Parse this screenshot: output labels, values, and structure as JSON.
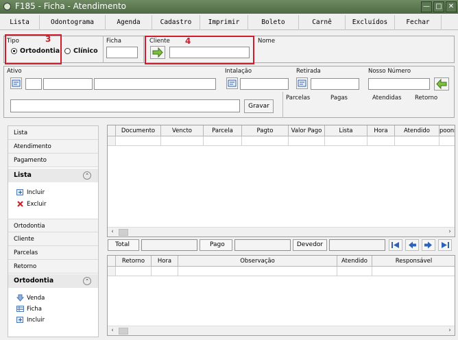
{
  "window": {
    "title": "F185 - Ficha - Atendimento"
  },
  "menu": [
    "Lista",
    "Odontograma",
    "Agenda",
    "Cadastro",
    "Imprimir",
    "Boleto",
    "Carnê",
    "Excluídos",
    "Fechar"
  ],
  "form": {
    "tipo_label": "Tipo",
    "tipo_options": [
      "Ortodontia",
      "Clínico"
    ],
    "tipo_selected": "Ortodontia",
    "ficha_label": "Ficha",
    "ficha_value": "",
    "cliente_label": "Cliente",
    "cliente_value": "",
    "nome_label": "Nome",
    "nome_value": "",
    "ativo_label": "Ativo",
    "instalacao_label": "Intalação",
    "retirada_label": "Retirada",
    "nosso_numero_label": "Nosso Número",
    "gravar_label": "Gravar",
    "summary_headers": [
      "Parcelas",
      "Pagas",
      "Atendidas",
      "Retorno"
    ]
  },
  "annotations": {
    "marker_3": "3",
    "marker_4": "4"
  },
  "sidebar": {
    "items_top": [
      "Lista",
      "Atendimento",
      "Pagamento"
    ],
    "lista_section": {
      "title": "Lista",
      "actions": [
        "Incluir",
        "Excluir"
      ]
    },
    "items_mid": [
      "Ortodontia",
      "Cliente",
      "Parcelas",
      "Retorno"
    ],
    "ortodontia_section": {
      "title": "Ortodontia",
      "actions": [
        "Venda",
        "Ficha",
        "Incluir"
      ]
    }
  },
  "grid1": {
    "columns": [
      "Documento",
      "Vencto",
      "Parcela",
      "Pagto",
      "Valor Pago",
      "Lista",
      "Hora",
      "Atendido",
      "poons"
    ]
  },
  "totals": {
    "total_label": "Total",
    "pago_label": "Pago",
    "devedor_label": "Devedor"
  },
  "grid2": {
    "columns": [
      "Retorno",
      "Hora",
      "Observação",
      "Atendido",
      "Responsável"
    ]
  },
  "colors": {
    "titlebar": "#5c7852",
    "annotation": "#d21b2a",
    "nav_arrow": "#2c63b8"
  }
}
